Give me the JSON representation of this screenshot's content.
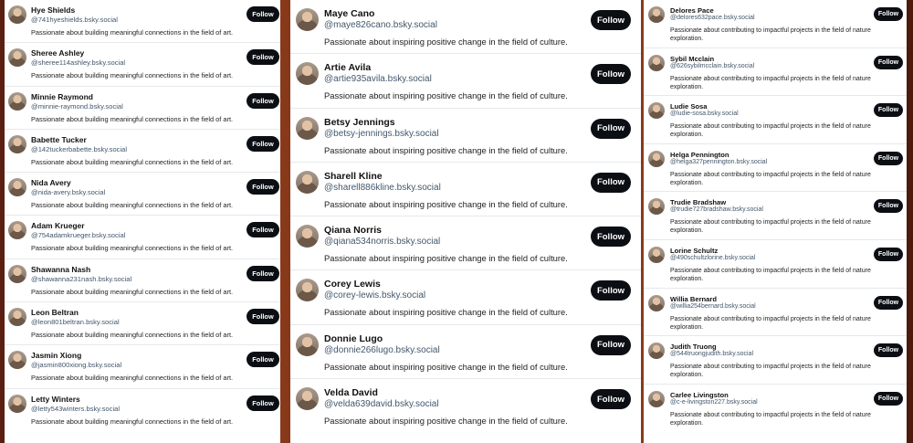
{
  "columns": [
    {
      "bio": "Passionate about building meaningful connections in the field of art.",
      "follow_label": "Follow",
      "users": [
        {
          "name": "Hye Shields",
          "handle": "@741hyeshields.bsky.social"
        },
        {
          "name": "Sheree Ashley",
          "handle": "@sheree114ashley.bsky.social"
        },
        {
          "name": "Minnie Raymond",
          "handle": "@minnie-raymond.bsky.social"
        },
        {
          "name": "Babette Tucker",
          "handle": "@142tuckerbabette.bsky.social"
        },
        {
          "name": "Nida Avery",
          "handle": "@nida-avery.bsky.social"
        },
        {
          "name": "Adam Krueger",
          "handle": "@754adamkrueger.bsky.social"
        },
        {
          "name": "Shawanna Nash",
          "handle": "@shawanna231nash.bsky.social"
        },
        {
          "name": "Leon Beltran",
          "handle": "@leon801beltran.bsky.social"
        },
        {
          "name": "Jasmin Xiong",
          "handle": "@jasmin800xiong.bsky.social"
        },
        {
          "name": "Letty Winters",
          "handle": "@letty543winters.bsky.social"
        }
      ]
    },
    {
      "bio": "Passionate about inspiring positive change in the field of culture.",
      "follow_label": "Follow",
      "users": [
        {
          "name": "Maye Cano",
          "handle": "@maye826cano.bsky.social"
        },
        {
          "name": "Artie Avila",
          "handle": "@artie935avila.bsky.social"
        },
        {
          "name": "Betsy Jennings",
          "handle": "@betsy-jennings.bsky.social"
        },
        {
          "name": "Sharell Kline",
          "handle": "@sharell886kline.bsky.social"
        },
        {
          "name": "Qiana Norris",
          "handle": "@qiana534norris.bsky.social"
        },
        {
          "name": "Corey Lewis",
          "handle": "@corey-lewis.bsky.social"
        },
        {
          "name": "Donnie Lugo",
          "handle": "@donnie266lugo.bsky.social"
        },
        {
          "name": "Velda David",
          "handle": "@velda639david.bsky.social"
        }
      ]
    },
    {
      "bio": "Passionate about contributing to impactful projects in the field of nature exploration.",
      "follow_label": "Follow",
      "users": [
        {
          "name": "Delores Pace",
          "handle": "@delores632pace.bsky.social"
        },
        {
          "name": "Sybil Mcclain",
          "handle": "@626sybilmcclain.bsky.social"
        },
        {
          "name": "Ludie Sosa",
          "handle": "@ludie-sosa.bsky.social"
        },
        {
          "name": "Helga Pennington",
          "handle": "@helga327pennington.bsky.social"
        },
        {
          "name": "Trudie Bradshaw",
          "handle": "@trudie727bradshaw.bsky.social"
        },
        {
          "name": "Lorine Schultz",
          "handle": "@490schultzlorine.bsky.social"
        },
        {
          "name": "Willia Bernard",
          "handle": "@willia254bernard.bsky.social"
        },
        {
          "name": "Judith Truong",
          "handle": "@544truongjudith.bsky.social"
        },
        {
          "name": "Carlee Livingston",
          "handle": "@c-e-livingston227.bsky.social"
        }
      ]
    }
  ]
}
